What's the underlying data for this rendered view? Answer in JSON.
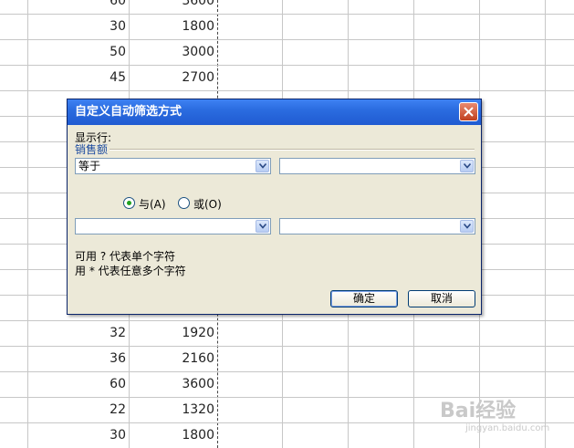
{
  "sheet": {
    "top_rows": [
      [
        "60",
        "3600"
      ],
      [
        "30",
        "1800"
      ],
      [
        "50",
        "3000"
      ],
      [
        "45",
        "2700"
      ]
    ],
    "bottom_rows": [
      [
        "32",
        "1920"
      ],
      [
        "36",
        "2160"
      ],
      [
        "60",
        "3600"
      ],
      [
        "22",
        "1320"
      ],
      [
        "30",
        "1800"
      ]
    ]
  },
  "dialog": {
    "title": "自定义自动筛选方式",
    "show_rows_label": "显示行:",
    "field_label": "销售额",
    "condition1": {
      "operator": "等于",
      "value": ""
    },
    "condition2": {
      "operator": "",
      "value": ""
    },
    "logic": {
      "and_label": "与(A)",
      "or_label": "或(O)",
      "selected": "and"
    },
    "hint_line1": "可用 ? 代表单个字符",
    "hint_line2": "用 * 代表任意多个字符",
    "ok_label": "确定",
    "cancel_label": "取消"
  },
  "watermark": {
    "brand": "Bai经验",
    "url": "jingyan.baidu.com"
  }
}
